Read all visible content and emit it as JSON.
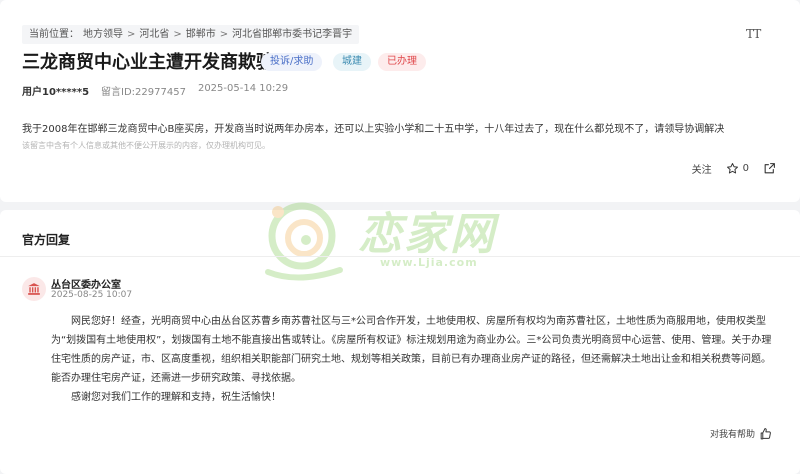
{
  "breadcrumb": {
    "label": "当前位置：",
    "items": [
      "地方领导",
      "河北省",
      "邯郸市",
      "河北省邯郸市委书记李晋宇"
    ],
    "separator": ">"
  },
  "font_tool": {
    "glyph": "TT"
  },
  "message": {
    "title": "三龙商贸中心业主遭开发商欺骗",
    "tags": {
      "type": "投诉/求助",
      "field": "城建",
      "status": "已办理"
    },
    "user": "用户10*****5",
    "message_id": "留言ID:22977457",
    "datetime": "2025-05-14 10:29",
    "content": "我于2008年在邯郸三龙商贸中心B座买房，开发商当时说两年办房本，还可以上实验小学和二十五中学，十八年过去了，现在什么都兑现不了，请领导协调解决",
    "disclaimer": "该留言中含有个人信息或其他不便公开展示的内容，仅办理机构可见。",
    "actions": {
      "follow_label": "关注",
      "like_count": "0"
    }
  },
  "reply": {
    "heading": "官方回复",
    "department": "丛台区委办公室",
    "datetime": "2025-08-25 10:07",
    "paragraphs": [
      "网民您好！经查，光明商贸中心由丛台区苏曹乡南苏曹社区与三*公司合作开发，土地使用权、房屋所有权均为南苏曹社区，土地性质为商服用地，使用权类型为“划拨国有土地使用权”，划拨国有土地不能直接出售或转让。《房屋所有权证》标注规划用途为商业办公。三*公司负责光明商贸中心运营、使用、管理。关于办理住宅性质的房产证，市、区高度重视，组织相关职能部门研究土地、规划等相关政策，目前已有办理商业房产证的路径，但还需解决土地出让金和相关税费等问题。能否办理住宅房产证，还需进一步研究政策、寻找依据。",
      "感谢您对我们工作的理解和支持，祝生活愉快！"
    ],
    "helpful_label": "对我有帮助"
  },
  "watermark": {
    "text": "恋家网",
    "url": "www.Ljia.com"
  },
  "colors": {
    "accent": "#4a6fc7",
    "status": "#e0484b",
    "dept_icon": "#d9534f",
    "watermark": "#6bbf3a"
  },
  "icons": [
    "font-size-icon",
    "star-icon",
    "share-icon",
    "government-building-icon",
    "thumbs-up-icon"
  ]
}
